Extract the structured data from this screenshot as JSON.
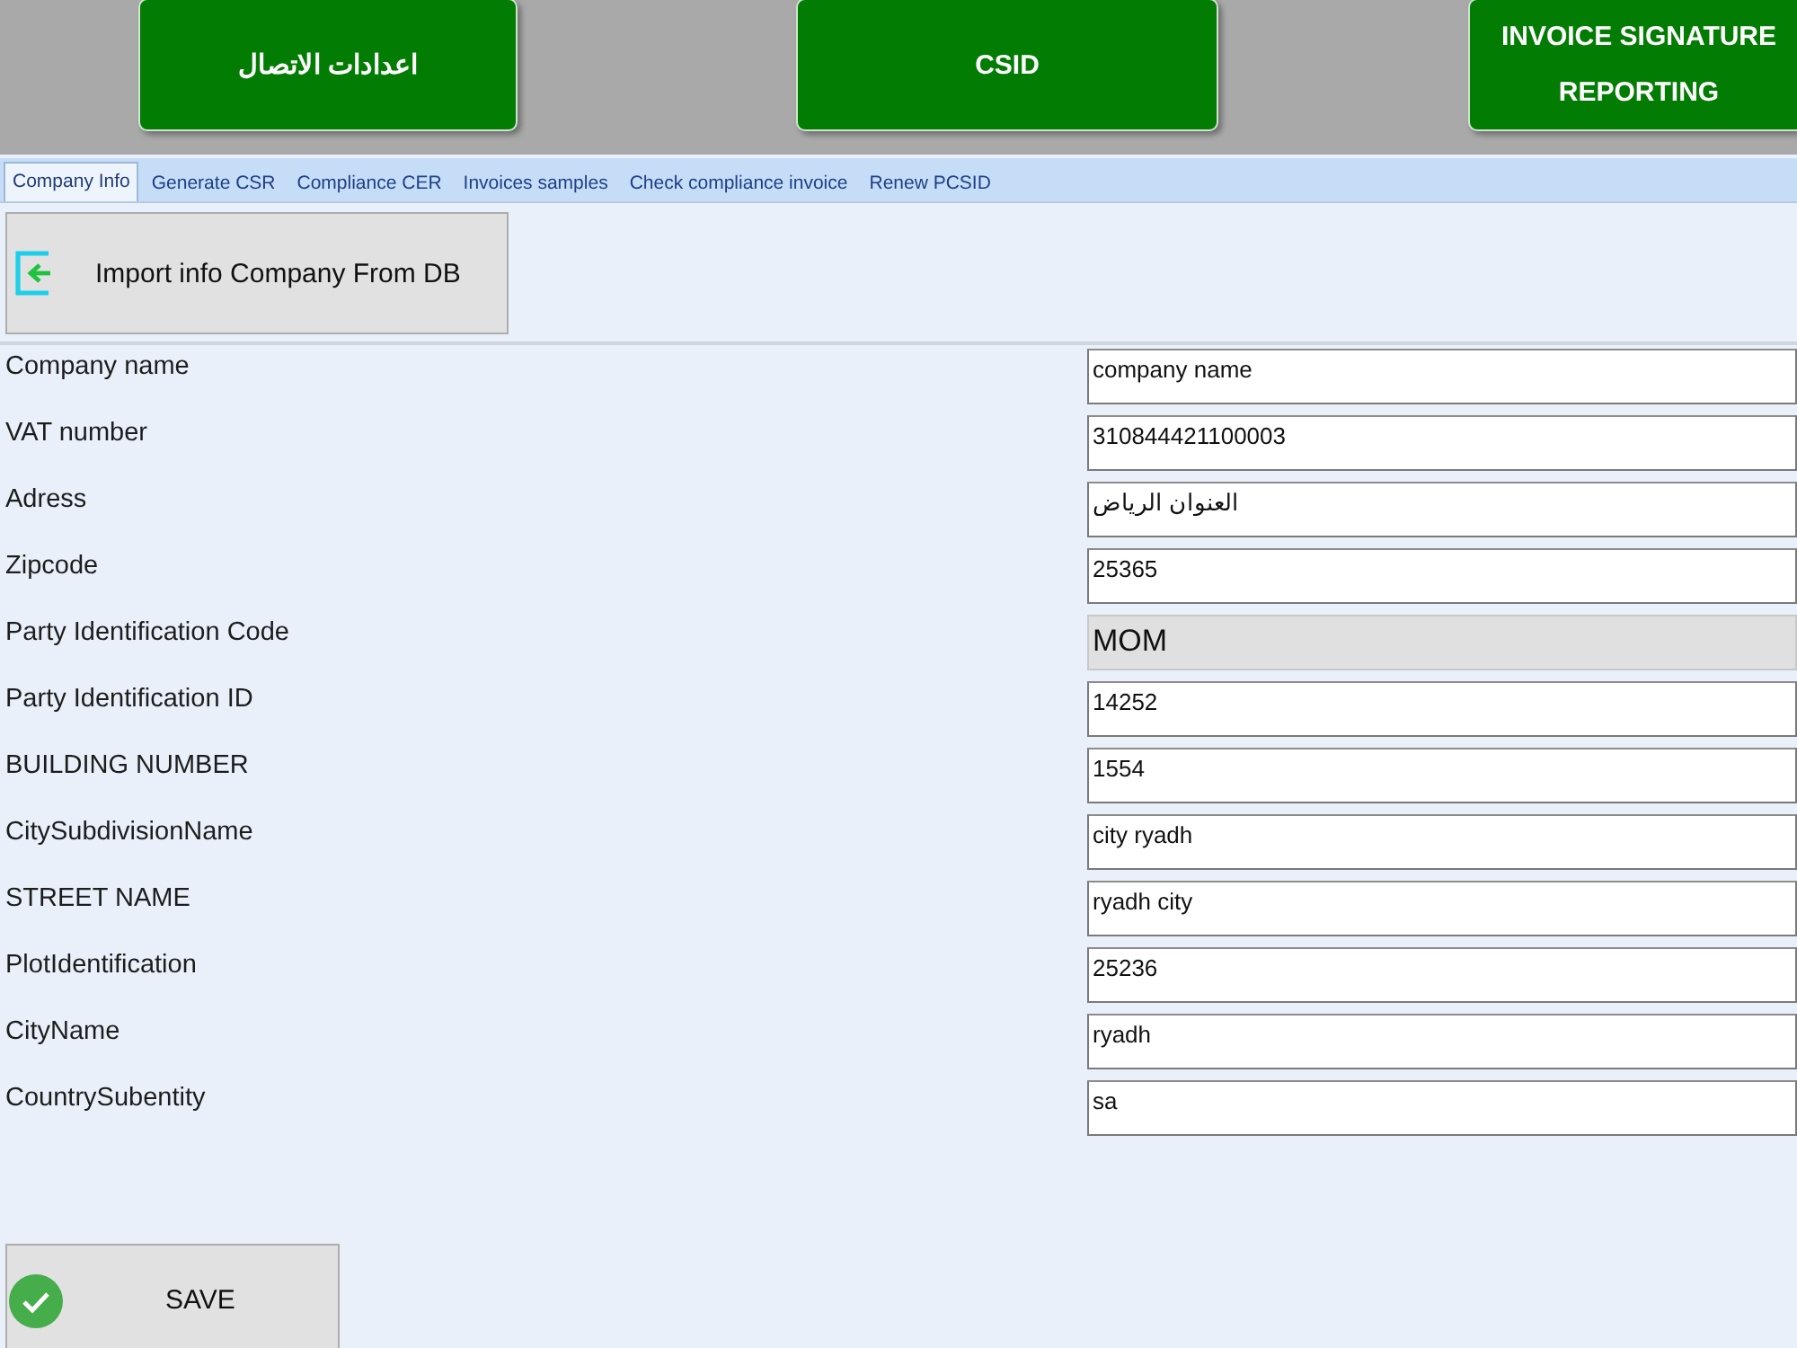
{
  "header_buttons": [
    {
      "label": "اعدادات الاتصال"
    },
    {
      "label": "CSID"
    },
    {
      "label": "INVOICE SIGNATURE REPORTING"
    }
  ],
  "tabs": [
    {
      "label": "Company Info",
      "selected": true
    },
    {
      "label": "Generate CSR",
      "selected": false
    },
    {
      "label": "Compliance CER",
      "selected": false
    },
    {
      "label": "Invoices samples",
      "selected": false
    },
    {
      "label": "Check compliance invoice",
      "selected": false
    },
    {
      "label": "Renew PCSID",
      "selected": false
    }
  ],
  "import_button": {
    "label": "Import info Company From DB"
  },
  "fields": [
    {
      "label": "Company name",
      "value": "company name",
      "disabled": false
    },
    {
      "label": "VAT number",
      "value": "310844421100003",
      "disabled": false
    },
    {
      "label": "Adress",
      "value": "العنوان الرياض",
      "disabled": false
    },
    {
      "label": "Zipcode",
      "value": "25365",
      "disabled": false
    },
    {
      "label": "Party Identification Code",
      "value": "MOM",
      "disabled": true
    },
    {
      "label": "Party Identification ID",
      "value": "14252",
      "disabled": false
    },
    {
      "label": "BUILDING NUMBER",
      "value": "1554",
      "disabled": false
    },
    {
      "label": "CitySubdivisionName",
      "value": "city ryadh",
      "disabled": false
    },
    {
      "label": "STREET NAME",
      "value": "ryadh city",
      "disabled": false
    },
    {
      "label": "PlotIdentification",
      "value": "25236",
      "disabled": false
    },
    {
      "label": "CityName",
      "value": "ryadh",
      "disabled": false
    },
    {
      "label": "CountrySubentity",
      "value": "sa",
      "disabled": false
    }
  ],
  "save_button": {
    "label": "SAVE"
  }
}
